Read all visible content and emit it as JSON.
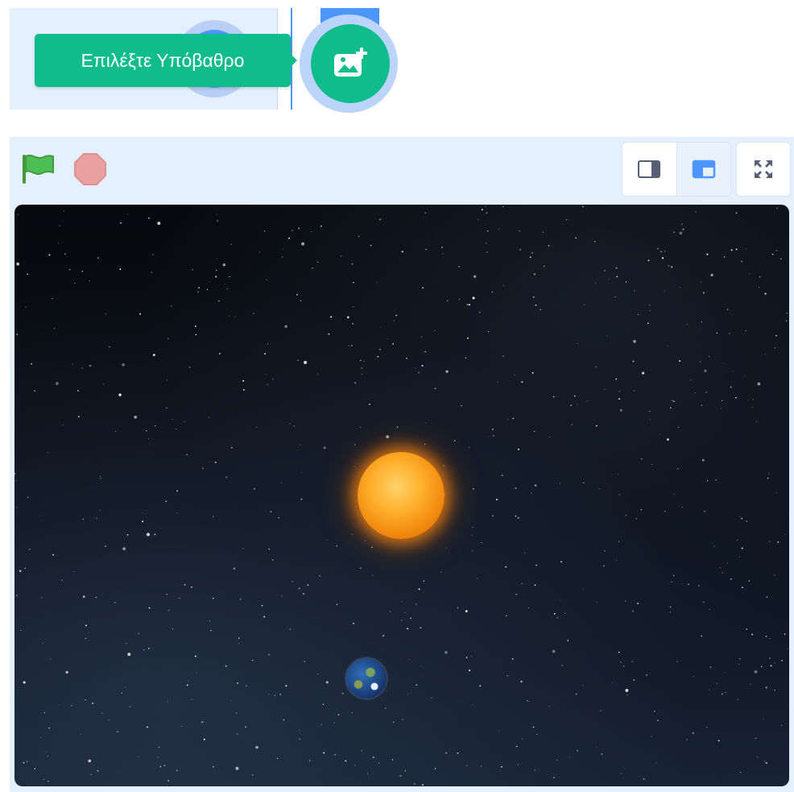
{
  "tooltip": {
    "text": "Επιλέξτε Υπόβαθρο"
  },
  "buttons": {
    "choose_backdrop_icon": "add-image-icon",
    "green_flag_icon": "green-flag-icon",
    "stop_icon": "stop-icon",
    "small_stage_icon": "small-stage-icon",
    "large_stage_icon": "large-stage-icon",
    "fullscreen_icon": "fullscreen-icon"
  },
  "colors": {
    "accent_green": "#0fbd8c",
    "accent_blue": "#4c97ff",
    "panel_bg": "#e5f0ff",
    "flag_green": "#4cbf56",
    "stop_red": "#ec5959"
  },
  "stage": {
    "sprites": [
      "sun",
      "earth"
    ]
  }
}
